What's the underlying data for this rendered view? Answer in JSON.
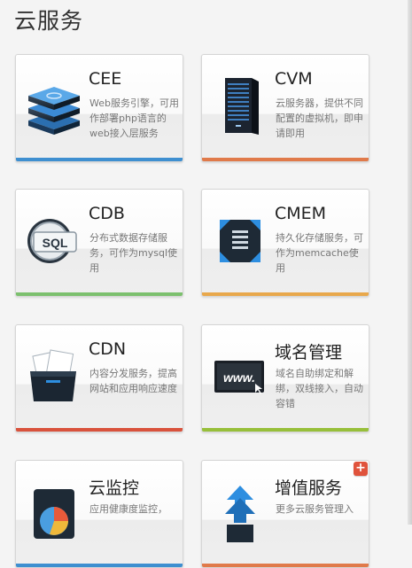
{
  "page": {
    "title": "云服务"
  },
  "colors": {
    "blue": "#3e8fd0",
    "orange": "#e07a4a",
    "green": "#7cc06e",
    "amber": "#e8a84c",
    "red": "#d9523c",
    "olive": "#97bf3a"
  },
  "cards": [
    {
      "name": "CEE",
      "desc": "Web服务引擎，可用作部署php语言的web接入层服务",
      "icon": "server-stack-icon",
      "bar": "#3e8fd0"
    },
    {
      "name": "CVM",
      "desc": "云服务器，提供不同配置的虚拟机，即申请即用",
      "icon": "server-tower-icon",
      "bar": "#e07a4a"
    },
    {
      "name": "CDB",
      "desc": "分布式数据存储服务，可作为mysql使用",
      "icon": "sql-database-icon",
      "bar": "#7cc06e"
    },
    {
      "name": "CMEM",
      "desc": "持久化存储服务，可作为memcache使用",
      "icon": "memory-cube-icon",
      "bar": "#e8a84c"
    },
    {
      "name": "CDN",
      "desc": "内容分发服务，提高网站和应用响应速度",
      "icon": "folder-files-icon",
      "bar": "#d9523c"
    },
    {
      "name": "域名管理",
      "desc": "域名自助绑定和解绑，双线接入，自动容错",
      "icon": "www-monitor-icon",
      "bar": "#97bf3a"
    },
    {
      "name": "云监控",
      "desc": "应用健康度监控，",
      "icon": "pie-chart-monitor-icon",
      "bar": "#3e8fd0"
    },
    {
      "name": "增值服务",
      "desc": "更多云服务管理入",
      "icon": "upload-arrows-icon",
      "bar": "#e07a4a"
    }
  ],
  "badge": {
    "label": "+"
  }
}
